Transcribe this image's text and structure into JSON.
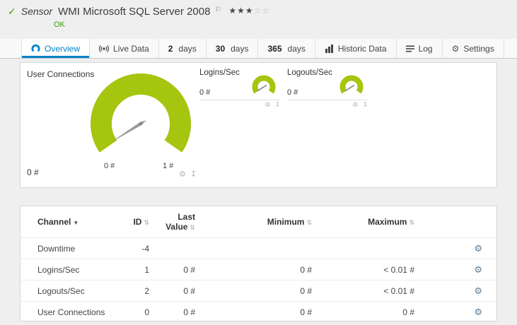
{
  "colors": {
    "gauge_green": "#a6c50f",
    "tab_active_blue": "#0082c8",
    "ok_green": "#2e9a07",
    "panel_border": "#d5d5d5"
  },
  "icons": {
    "check": "✓",
    "flag": "⚐",
    "gear": "⚙",
    "download": "↧",
    "sort": "⇅",
    "sort_desc": "▼"
  },
  "header": {
    "kind": "Sensor",
    "title": "WMI Microsoft SQL Server 2008",
    "status": "OK",
    "stars_filled": "★★★",
    "stars_empty": "☆☆"
  },
  "tabs": [
    {
      "label": "Overview"
    },
    {
      "label": "Live Data"
    },
    {
      "num": "2",
      "label": "days"
    },
    {
      "num": "30",
      "label": "days"
    },
    {
      "num": "365",
      "label": "days"
    },
    {
      "label": "Historic Data"
    },
    {
      "label": "Log"
    },
    {
      "label": "Settings"
    }
  ],
  "gauges": {
    "main": {
      "title": "User Connections",
      "value": "0 #",
      "scale_min": "0 #",
      "scale_max": "1 #"
    },
    "logins": {
      "title": "Logins/Sec",
      "value": "0 #"
    },
    "logouts": {
      "title": "Logouts/Sec",
      "value": "0 #"
    }
  },
  "table": {
    "headers": {
      "channel": "Channel",
      "id": "ID",
      "last_value": "Last Value",
      "minimum": "Minimum",
      "maximum": "Maximum"
    },
    "rows": [
      {
        "channel": "Downtime",
        "id": "-4",
        "last": "",
        "min": "",
        "max": ""
      },
      {
        "channel": "Logins/Sec",
        "id": "1",
        "last": "0 #",
        "min": "0 #",
        "max": "< 0.01 #"
      },
      {
        "channel": "Logouts/Sec",
        "id": "2",
        "last": "0 #",
        "min": "0 #",
        "max": "< 0.01 #"
      },
      {
        "channel": "User Connections",
        "id": "0",
        "last": "0 #",
        "min": "0 #",
        "max": "0 #"
      }
    ]
  }
}
